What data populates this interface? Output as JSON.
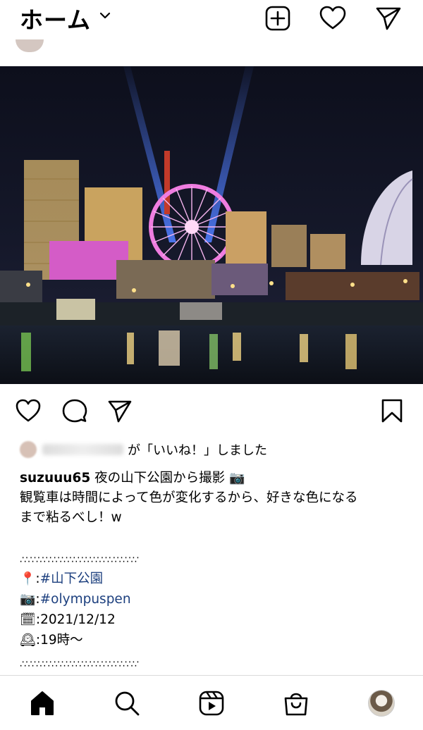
{
  "header": {
    "title": "ホーム",
    "icons": [
      "add-post-icon",
      "heart-icon",
      "direct-message-icon"
    ]
  },
  "post": {
    "liked_by_suffix": "が「いいね！」しました",
    "caption": {
      "username": "suzuuu65",
      "line1_text": " 夜の山下公園から撮影",
      "line2": "観覧車は時間によって色が変化するから、好きな色になる",
      "line3": "まで粘るべし！w",
      "divider1": "∴∵∴∵∴∵∴∵∴∵∴∵∴∵∴∵∴∵∴∵",
      "location_prefix": ":",
      "location_tag": "#山下公園",
      "camera_prefix": ":",
      "camera_tag": "#olympuspen",
      "date": ":2021/12/12",
      "time": ":19時〜",
      "divider2": "∴∵∴∵∴∵∴∵∴∵∴∵∴∵∴∵∴∵∴∵"
    },
    "emojis": {
      "camera": "📷",
      "pin": "📍",
      "calendar": "🗓",
      "clock": "🕰"
    }
  },
  "nav": {
    "items": [
      "home-icon",
      "search-icon",
      "reels-icon",
      "shop-icon",
      "profile-avatar"
    ]
  },
  "colors": {
    "hashtag": "#1c3f7e",
    "divider": "#dbdbdb"
  }
}
